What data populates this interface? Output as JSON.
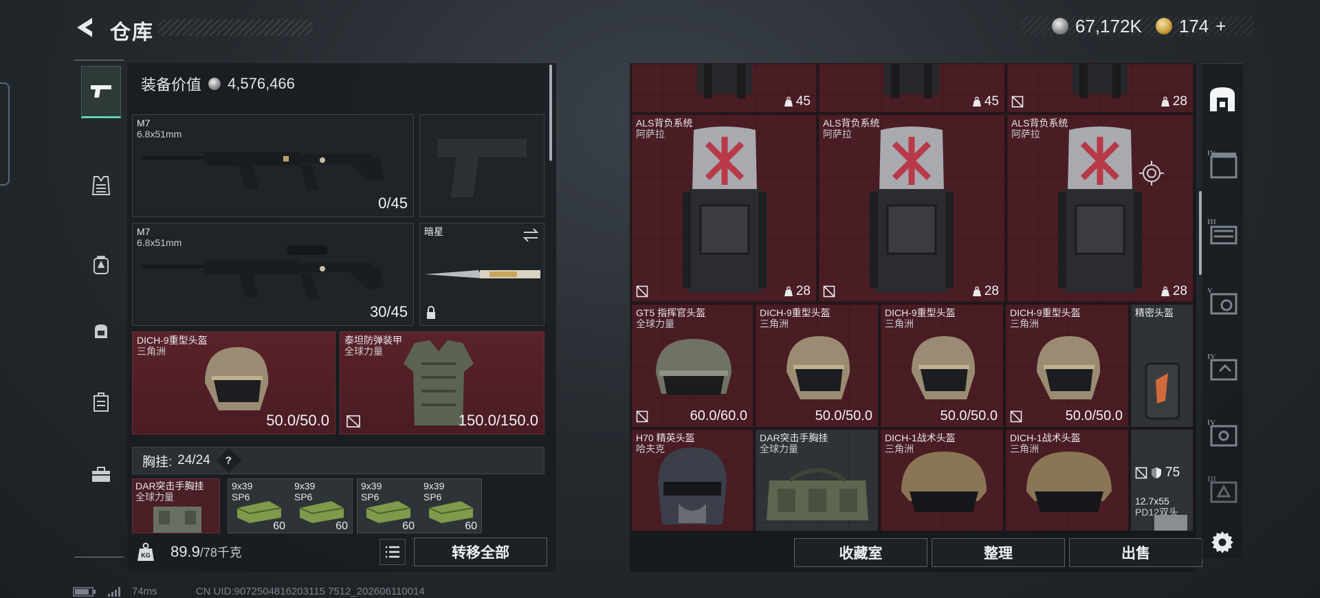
{
  "header": {
    "title": "仓库",
    "currency_silver": "67,172K",
    "currency_gold": "174",
    "gold_add": "+"
  },
  "loadout": {
    "equip_value_label": "装备价值",
    "equip_value": "4,576,466",
    "primary_1": {
      "name": "M7",
      "caliber": "6.8x51mm",
      "ammo": "0/45"
    },
    "primary_2": {
      "name": "M7",
      "caliber": "6.8x51mm",
      "ammo": "30/45"
    },
    "melee": {
      "name": "暗星"
    },
    "helmet": {
      "name": "DICH-9重型头盔",
      "faction": "三角洲",
      "durability": "50.0/50.0"
    },
    "armor": {
      "name": "泰坦防弹装甲",
      "faction": "全球力量",
      "durability": "150.0/150.0"
    },
    "chest": {
      "label": "胸挂: ",
      "capacity": "24/24",
      "help": "?",
      "rig_item": {
        "name": "DAR突击手胸挂",
        "faction": "全球力量"
      },
      "ammo": [
        {
          "name": "9x39",
          "type": "SP6",
          "count": "60"
        },
        {
          "name": "9x39",
          "type": "SP6",
          "count": "60"
        },
        {
          "name": "9x39",
          "type": "SP6",
          "count": "60"
        },
        {
          "name": "9x39",
          "type": "SP6",
          "count": "60"
        }
      ]
    },
    "weight": {
      "current": "89.9",
      "max": "/78千克"
    },
    "transfer_all": "转移全部"
  },
  "storage": {
    "top_row": [
      {
        "count": "45"
      },
      {
        "count": "45"
      },
      {
        "count": "28"
      }
    ],
    "backpacks": [
      {
        "name": "ALS背负系统",
        "faction": "阿萨拉",
        "count": "28"
      },
      {
        "name": "ALS背负系统",
        "faction": "阿萨拉",
        "count": "28"
      },
      {
        "name": "ALS背负系统",
        "faction": "阿萨拉",
        "count": "28"
      }
    ],
    "helmets_row1": [
      {
        "name": "GT5 指挥官头盔",
        "faction": "全球力量",
        "durability": "60.0/60.0"
      },
      {
        "name": "DICH-9重型头盔",
        "faction": "三角洲",
        "durability": "50.0/50.0"
      },
      {
        "name": "DICH-9重型头盔",
        "faction": "三角洲",
        "durability": "50.0/50.0"
      },
      {
        "name": "DICH-9重型头盔",
        "faction": "三角洲",
        "durability": "50.0/50.0"
      },
      {
        "name": "精密头盔",
        "faction": ""
      }
    ],
    "row3": [
      {
        "name": "H70 精英头盔",
        "faction": "哈夫克"
      },
      {
        "name": "DAR突击手胸挂",
        "faction": "全球力量"
      },
      {
        "name": "DICH-1战术头盔",
        "faction": "三角洲"
      },
      {
        "name": "DICH-1战术头盔",
        "faction": "三角洲"
      },
      {
        "name": "12.7x55",
        "type": "PD12双头",
        "count": "75"
      }
    ],
    "actions": {
      "collection": "收藏室",
      "organize": "整理",
      "sell": "出售"
    }
  },
  "right_rail": {
    "tiers": [
      "IV",
      "III",
      "V",
      "IV",
      "IV",
      "III"
    ]
  },
  "status": {
    "ping": "74ms",
    "uid": "CN UID:9072504816203115 7512_202606110014"
  },
  "colors": {
    "accent": "#5fd4b0",
    "item_red": "#4a1c24",
    "panel": "#181c20"
  }
}
